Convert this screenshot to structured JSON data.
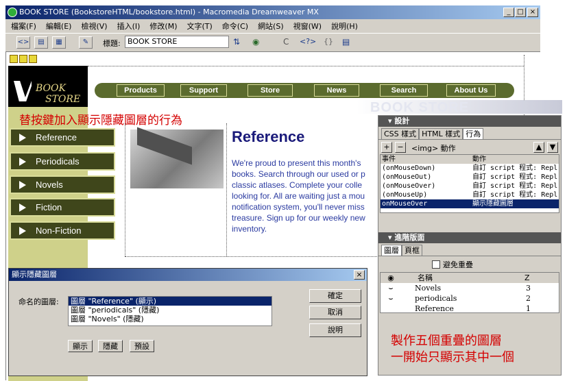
{
  "window": {
    "title": "BOOK STORE (BookstoreHTML/bookstore.html) - Macromedia Dreamweaver MX",
    "controls": {
      "minimize": "_",
      "maximize": "□",
      "close": "×"
    }
  },
  "menu": [
    "檔案(F)",
    "編輯(E)",
    "檢視(V)",
    "插入(I)",
    "修改(M)",
    "文字(T)",
    "命令(C)",
    "網站(S)",
    "視窗(W)",
    "說明(H)"
  ],
  "toolbar": {
    "title_label": "標題:",
    "title_value": "BOOK STORE",
    "code_glyph": "<?>",
    "braces_glyph": "{}",
    "refresh_glyph": "C"
  },
  "page": {
    "logo_line1": "BOOK",
    "logo_line2": "STORE",
    "nav": [
      "Products",
      "Support",
      "Store",
      "News",
      "Search",
      "About Us"
    ],
    "banner": "BOOK STORE",
    "sidebar": [
      "Reference",
      "Periodicals",
      "Novels",
      "Fiction",
      "Non-Fiction"
    ],
    "heading": "Reference",
    "body_lines": [
      "We're proud to present this month's",
      "books. Search through our used or p",
      "classic atlases. Complete your colle",
      "looking for. All are waiting just a mou",
      "notification system, you'll never miss",
      "treasure. Sign up for our weekly new",
      "inventory."
    ]
  },
  "annotations": {
    "top": "替按鍵加入顯示隱藏圖層的行為",
    "bottom_line1": "製作五個重疊的圖層",
    "bottom_line2": "一開始只顯示其中一個"
  },
  "design_panel": {
    "title": "▾ 設計",
    "tabs": [
      "CSS 樣式",
      "HTML 樣式",
      "行為"
    ],
    "tag_label": "<img> 動作",
    "col_event": "事件",
    "col_action": "動作",
    "rows": [
      {
        "event": "(onMouseDown)",
        "action": "自訂 script 程式: Repl"
      },
      {
        "event": "(onMouseOut)",
        "action": "自訂 script 程式: Repl"
      },
      {
        "event": "(onMouseOver)",
        "action": "自訂 script 程式: Repl"
      },
      {
        "event": "(onMouseUp)",
        "action": "自訂 script 程式: Repl"
      },
      {
        "event": "onMouseOver",
        "action": "顯示隱藏圖層",
        "selected": true
      }
    ]
  },
  "advanced_panel": {
    "title": "▾ 進階版面",
    "tabs": [
      "圖層",
      "頁框"
    ],
    "checkbox_label": "避免重疊",
    "col_name": "名稱",
    "col_z": "Z",
    "layers": [
      {
        "name": "Novels",
        "z": "3"
      },
      {
        "name": "periodicals",
        "z": "2"
      },
      {
        "name": "Reference",
        "z": "1"
      }
    ]
  },
  "dialog": {
    "title": "顯示隱藏圖層",
    "close": "×",
    "label": "命名的圖層:",
    "layers": [
      "圖層 \"Reference\" (顯示)",
      "圖層 \"periodicals\" (隱藏)",
      "圖層 \"Novels\" (隱藏)"
    ],
    "buttons_right": [
      "確定",
      "取消",
      "說明"
    ],
    "buttons_bottom": [
      "顯示",
      "隱藏",
      "預設"
    ]
  }
}
